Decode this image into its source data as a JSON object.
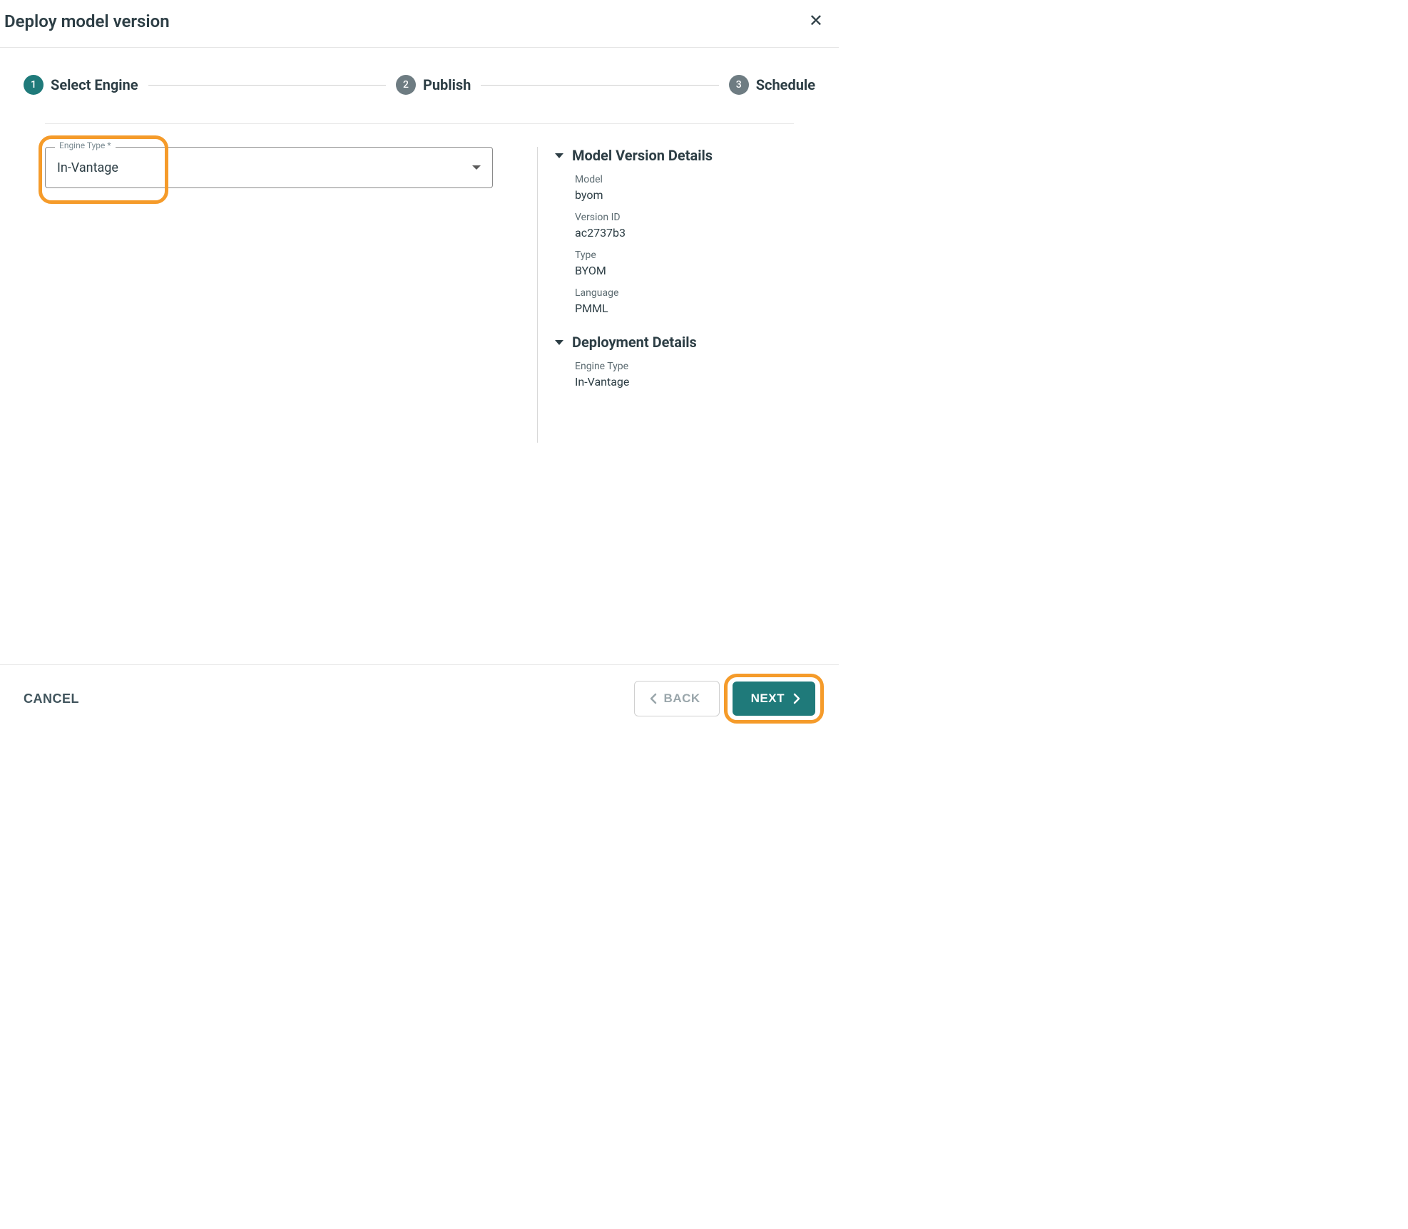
{
  "header": {
    "title": "Deploy model version"
  },
  "stepper": {
    "steps": [
      {
        "num": "1",
        "label": "Select Engine",
        "active": true
      },
      {
        "num": "2",
        "label": "Publish",
        "active": false
      },
      {
        "num": "3",
        "label": "Schedule",
        "active": false
      }
    ]
  },
  "engineTypeField": {
    "label": "Engine Type *",
    "value": "In-Vantage"
  },
  "modelVersionDetails": {
    "title": "Model Version Details",
    "items": [
      {
        "label": "Model",
        "value": "byom"
      },
      {
        "label": "Version ID",
        "value": "ac2737b3"
      },
      {
        "label": "Type",
        "value": "BYOM"
      },
      {
        "label": "Language",
        "value": "PMML"
      }
    ]
  },
  "deploymentDetails": {
    "title": "Deployment Details",
    "items": [
      {
        "label": "Engine Type",
        "value": "In-Vantage"
      }
    ]
  },
  "footer": {
    "cancel": "CANCEL",
    "back": "BACK",
    "next": "NEXT"
  }
}
